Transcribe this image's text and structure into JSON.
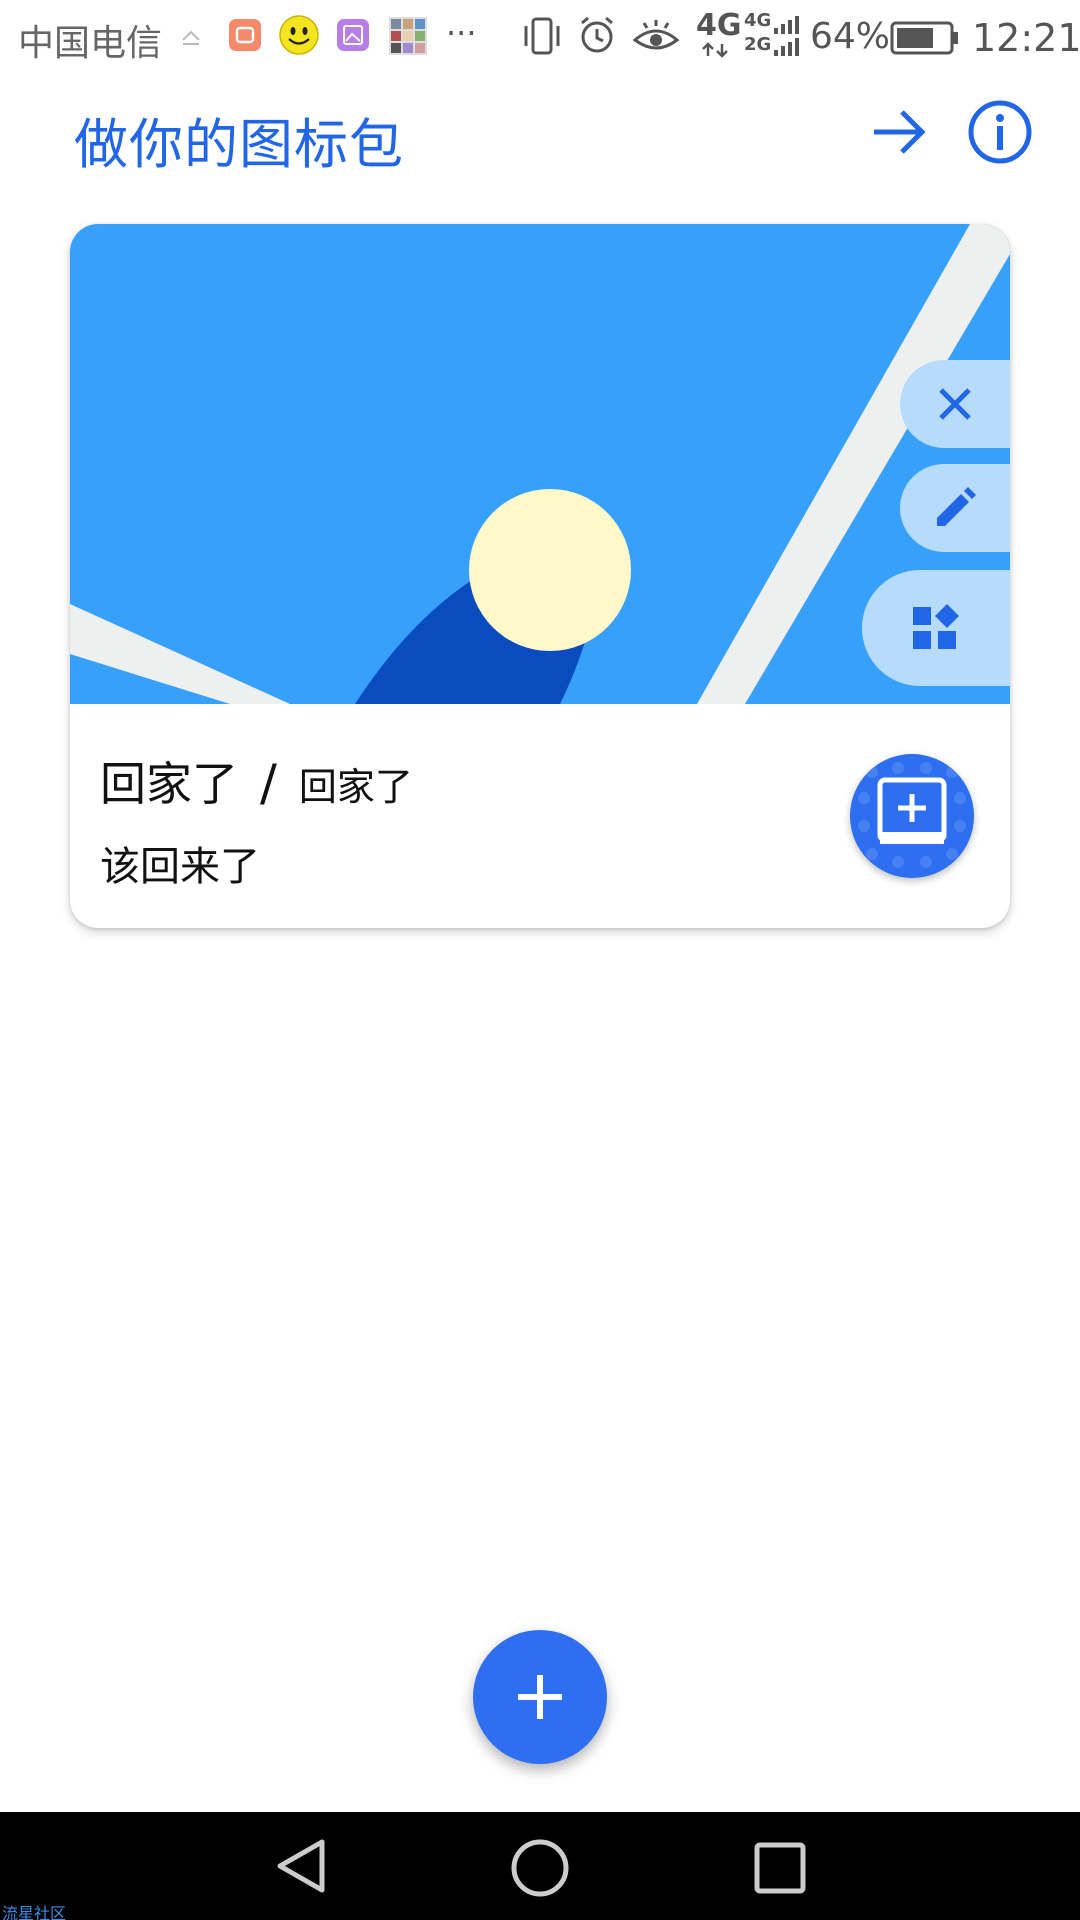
{
  "status_bar": {
    "carrier": "中国电信",
    "network": "4G",
    "network_secondary_top": "4G",
    "network_secondary_bottom": "2G",
    "battery": "64%",
    "time": "12:21",
    "more": "···"
  },
  "header": {
    "title": "做你的图标包",
    "next_icon": "arrow-right-icon",
    "info_icon": "info-icon"
  },
  "card": {
    "title": "回家了",
    "separator": "/",
    "name": "回家了",
    "description": "该回来了",
    "actions": [
      "close-icon",
      "edit-icon",
      "widgets-icon"
    ],
    "add_icon": "add-to-screen-icon"
  },
  "fab": {
    "icon": "plus-icon"
  },
  "nav": {
    "back_icon": "back-triangle-icon",
    "home_icon": "home-circle-icon",
    "recent_icon": "recent-square-icon"
  },
  "watermark": "流星社区",
  "colors": {
    "accent": "#2266e8",
    "hero_sky": "#36a0fa",
    "sun": "#fff8c8",
    "hill": "#0a4bbf",
    "pill": "#b7dcfb"
  }
}
